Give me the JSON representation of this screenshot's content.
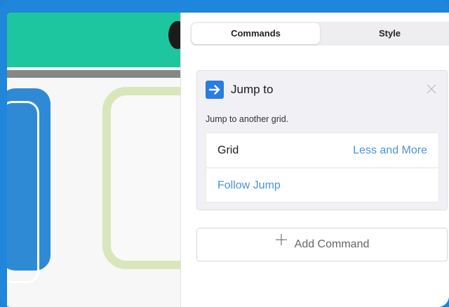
{
  "tabs": {
    "commands_label": "Commands",
    "style_label": "Style",
    "selected": "Commands"
  },
  "command": {
    "icon": "arrow-right-icon",
    "title": "Jump to",
    "description": "Jump to another grid.",
    "options": {
      "grid_label": "Grid",
      "grid_value": "Less and More",
      "follow_link": "Follow Jump"
    }
  },
  "add_command": {
    "label": "Add Command",
    "icon": "plus-icon"
  },
  "colors": {
    "frame_blue": "#1f86db",
    "header_green": "#1ec69f",
    "accent_blue": "#2a7ddc",
    "link_blue": "#4b93d8"
  }
}
